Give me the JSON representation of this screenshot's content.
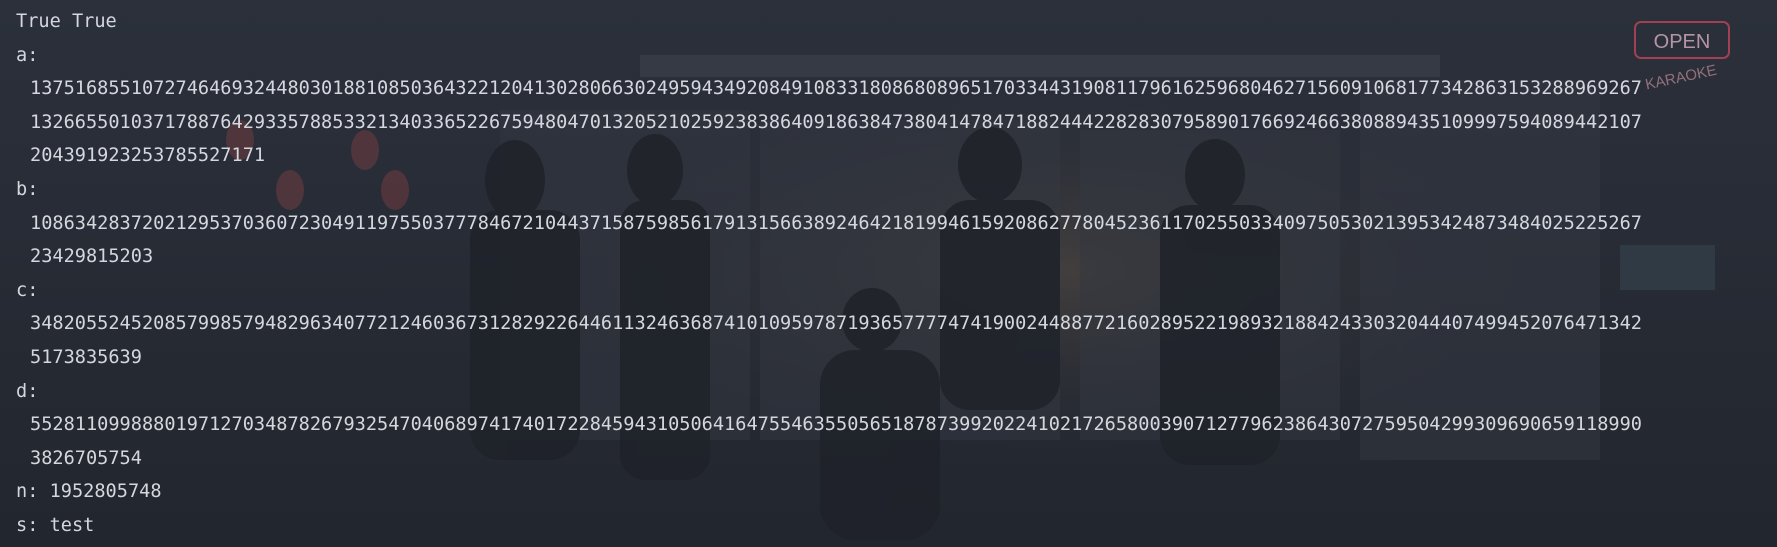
{
  "output": {
    "lines": [
      {
        "text": "True True",
        "indent": false
      },
      {
        "text": "a:",
        "indent": false
      },
      {
        "text": "1375168551072746469324480301881085036432212041302806630249594349208491083318086808965170334431908117961625968046271560910681773428631532889692​67",
        "indent": true
      },
      {
        "text": "1326655010371788764293357885332134033652267594804701320521025923838640918638473804147847188244422828307958901766924663808894351099975940894421​07",
        "indent": true
      },
      {
        "text": "2043919232537855271​71",
        "indent": true
      },
      {
        "text": "b:",
        "indent": false
      },
      {
        "text": "1086342837202129537036072304911975503777846721044371587598561791315663892464218199461592086277804523611702550334097505302139534248734840252252​67",
        "indent": true
      },
      {
        "text": "23429815203",
        "indent": true
      },
      {
        "text": "c:",
        "indent": false
      },
      {
        "text": "3482055245208579985794829634077212460367312829226446113246368741010959787193657777474190024488772160289522198932188424330320444074994520764713​42",
        "indent": true
      },
      {
        "text": "5173835639",
        "indent": true
      },
      {
        "text": "d:",
        "indent": false
      },
      {
        "text": "5528110998880197127034878267932547040689741740172284594310506416475546355056518787399202241021726580039071277962386430727595042993096906591189​90",
        "indent": true
      },
      {
        "text": "3826705754",
        "indent": true
      },
      {
        "text": "n: 1952805748",
        "indent": false
      },
      {
        "text": "s: test",
        "indent": false
      }
    ]
  },
  "background": {
    "signs": [
      "OPEN",
      "KARAOKE"
    ]
  }
}
